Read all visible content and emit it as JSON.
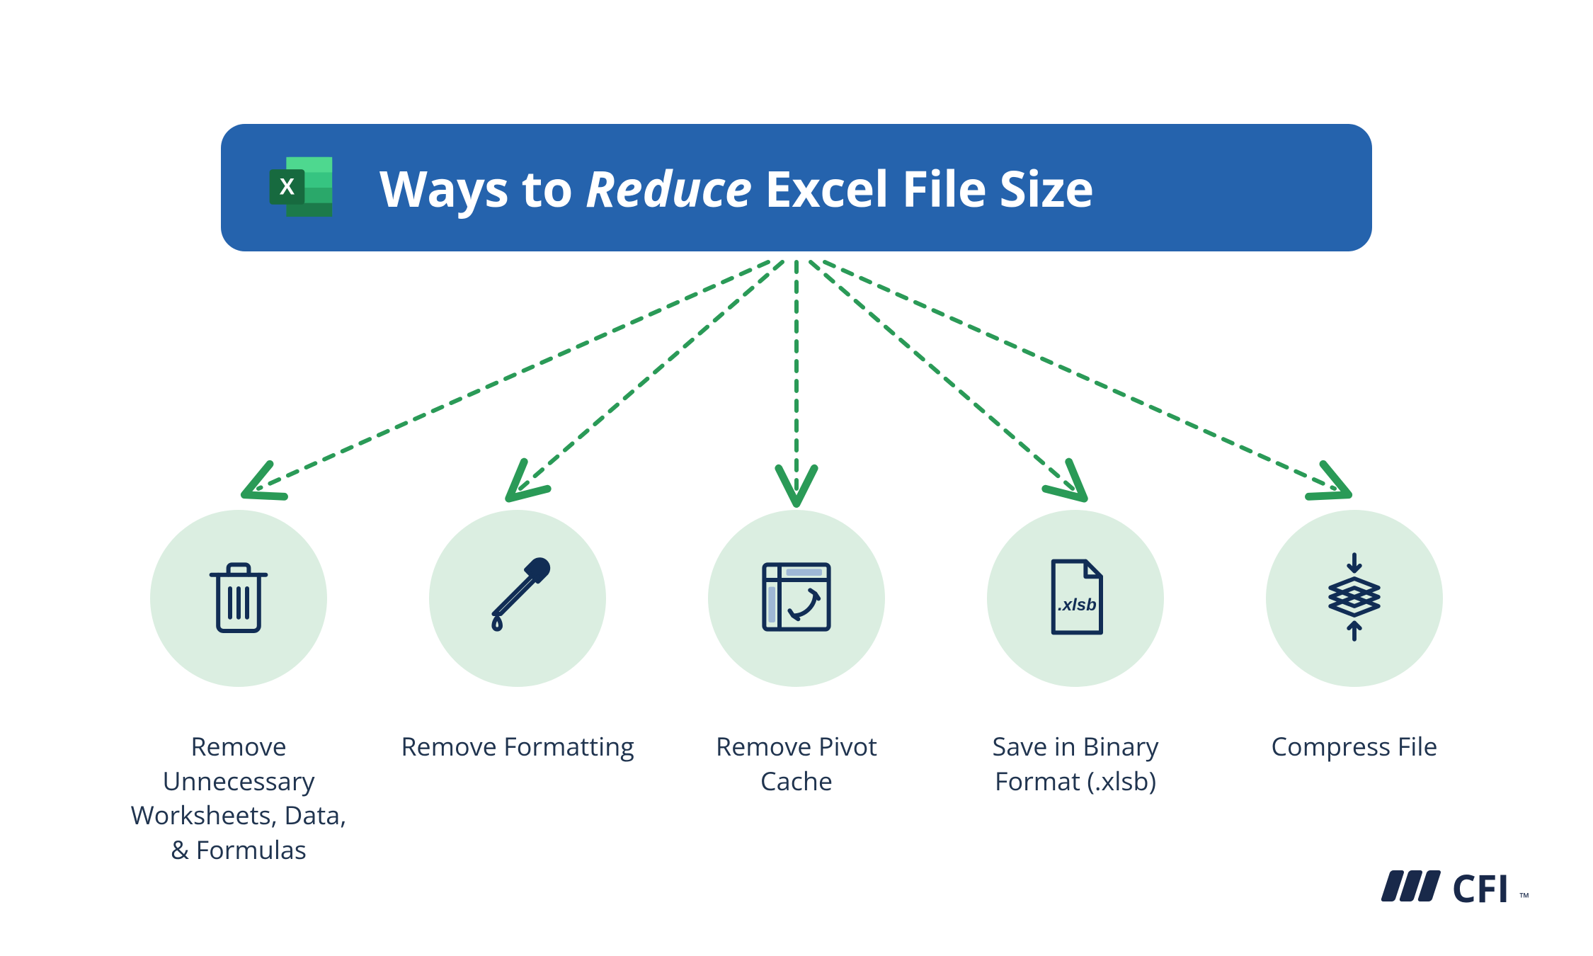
{
  "title": {
    "prefix": "Ways to ",
    "emphasis": "Reduce",
    "suffix": " Excel File Size"
  },
  "items": [
    {
      "icon": "trash-icon",
      "label": "Remove Unnecessary Worksheets, Data, & Formulas"
    },
    {
      "icon": "eyedropper-icon",
      "label": "Remove Formatting"
    },
    {
      "icon": "pivot-icon",
      "label": "Remove Pivot Cache"
    },
    {
      "icon": "file-xlsb-icon",
      "label": "Save in Binary Format (.xlsb)"
    },
    {
      "icon": "compress-icon",
      "label": "Compress File"
    }
  ],
  "brand": {
    "name": "CFI",
    "trademark": "™"
  },
  "colors": {
    "title_bg": "#2563ad",
    "circle_bg": "#dbeee1",
    "arrow": "#2a9a57",
    "text_dark": "#20344f",
    "icon_stroke": "#112d55"
  }
}
